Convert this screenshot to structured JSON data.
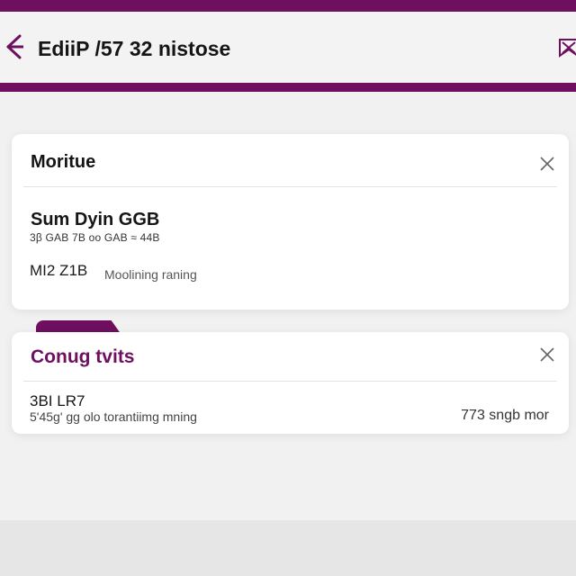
{
  "header": {
    "title": "EdiiP /57 32 nistose",
    "back_icon": "arrow-left-icon",
    "action_icon": "bookmark-x-icon"
  },
  "cards": [
    {
      "title": "Moritue",
      "primary": "Sum Dyin GGB",
      "secondary": "3β GAB 7B oo GAB ≈ 44B",
      "meta_value": "MI2 Z1B",
      "meta_label": "Moolining raning"
    },
    {
      "title": "Conug tvits",
      "primary": "3BI LR7",
      "secondary": "5'45g' ɡg olo torantiimg mning",
      "right_value": "773 sngb mor"
    }
  ],
  "colors": {
    "accent": "#6f0f5f",
    "background": "#f1f1f1",
    "card": "#ffffff"
  }
}
